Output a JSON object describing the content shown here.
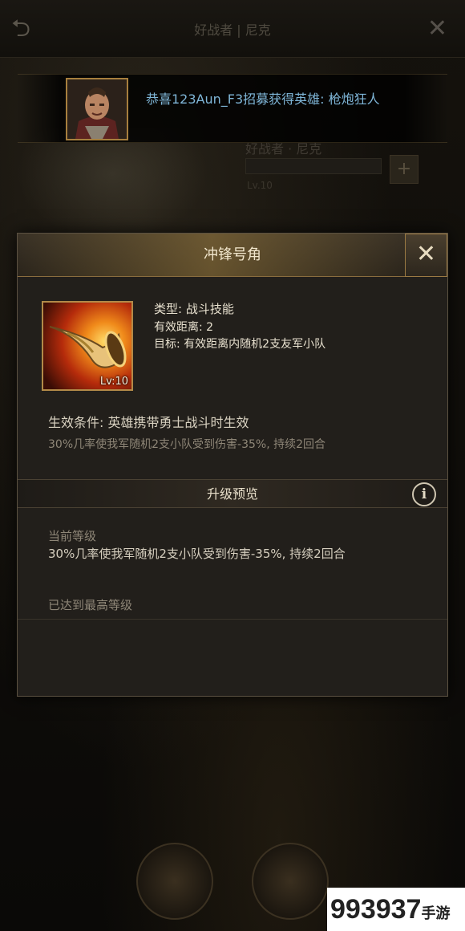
{
  "background": {
    "title": "好战者 | 尼克",
    "hero_name": "好战者 · 尼克",
    "hero_level": "Lv.10"
  },
  "notification": {
    "text": "恭喜123Aun_F3招募获得英雄: 枪炮狂人",
    "color": "#7fb6d8"
  },
  "dialog": {
    "title": "冲锋号角",
    "close_label": "✕",
    "skill": {
      "level": "Lv:10",
      "type": "类型: 战斗技能",
      "range": "有效距离: 2",
      "target": "目标: 有效距离内随机2支友军小队"
    },
    "effect_condition": "生效条件: 英雄携带勇士战斗时生效",
    "effect_description": "30%几率使我军随机2支小队受到伤害-35%, 持续2回合",
    "upgrade_section": {
      "title": "升级预览",
      "info_icon": "i",
      "current_level_label": "当前等级",
      "current_level_desc": "30%几率使我军随机2支小队受到伤害-35%, 持续2回合",
      "max_level_text": "已达到最高等级"
    }
  },
  "watermark": {
    "number": "993937",
    "suffix": "手游"
  },
  "colors": {
    "accent_gold": "#b28a48",
    "dialog_bg": "#221f1b",
    "muted_text": "#8e8677"
  }
}
